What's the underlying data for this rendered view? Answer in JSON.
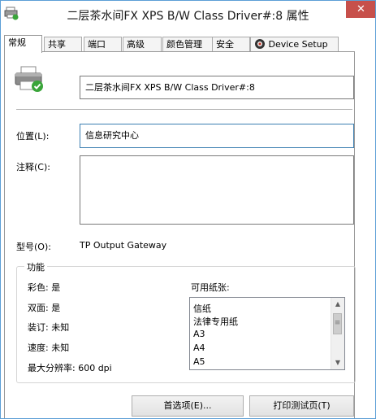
{
  "window": {
    "title": "二层茶水间FX XPS B/W Class Driver#:8 属性",
    "close_glyph": "✕"
  },
  "tabs": [
    {
      "label": "常规",
      "active": true
    },
    {
      "label": "共享"
    },
    {
      "label": "端口"
    },
    {
      "label": "高级"
    },
    {
      "label": "颜色管理"
    },
    {
      "label": "安全"
    },
    {
      "label": "Device Setup",
      "icon": "gear-icon"
    }
  ],
  "general": {
    "printer_icon": "printer-icon",
    "printer_name": "二层茶水间FX XPS B/W Class Driver#:8",
    "location_label": "位置(L):",
    "location_value": "信息研究中心",
    "comment_label": "注释(C):",
    "comment_value": "",
    "model_label": "型号(O):",
    "model_value": "TP Output Gateway"
  },
  "features": {
    "title": "功能",
    "color": "彩色: 是",
    "duplex": "双面: 是",
    "staple": "装订: 未知",
    "speed": "速度: 未知",
    "resolution": "最大分辨率: 600 dpi",
    "paper_label": "可用纸张:",
    "paper_sizes": [
      "信纸",
      "法律专用纸",
      "A3",
      "A4",
      "A5"
    ]
  },
  "buttons": {
    "preferences": "首选项(E)...",
    "print_test": "打印测试页(T)"
  },
  "colors": {
    "close_bg": "#c7504b",
    "focus_border": "#3c7fb1",
    "window_border": "#5c9fd6"
  }
}
